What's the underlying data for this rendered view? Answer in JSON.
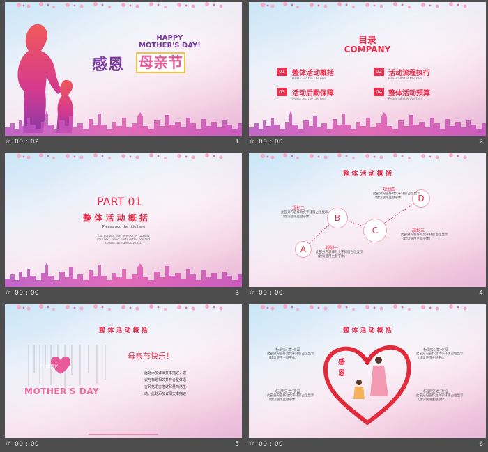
{
  "slides": [
    {
      "num": "1",
      "time": "00 : 02",
      "title_en": "HAPPY\nMOTHER'S DAY!",
      "title_cn_a": "感恩",
      "title_cn_b": "母亲节"
    },
    {
      "num": "2",
      "time": "00 : 00",
      "title": "目录",
      "subtitle": "COMPANY",
      "items": [
        {
          "n": "01",
          "label": "整体活动概括",
          "sub": "Please add the title here"
        },
        {
          "n": "02",
          "label": "活动流程执行",
          "sub": "Please add the title here"
        },
        {
          "n": "03",
          "label": "活动后勤保障",
          "sub": "Please add the title here"
        },
        {
          "n": "04",
          "label": "整体活动预算",
          "sub": "Please add the title here"
        }
      ]
    },
    {
      "num": "3",
      "time": "00 : 00",
      "part": "PART 01",
      "title": "整 体 活 动 概 括",
      "sub": "Please add the title here",
      "desc": "Your content play here, or by copying your text, select paste in this box and choose to retain only text."
    },
    {
      "num": "4",
      "time": "00 : 00",
      "title": "整 体 活 动 概 括",
      "nodes": [
        {
          "letter": "A",
          "label": "规划一",
          "desc": "此部分内容作为文字排版占位显示\n（建议使用主题字体）"
        },
        {
          "letter": "B",
          "label": "规划二",
          "desc": "此部分内容作为文字排版占位显示\n（建议使用主题字体）"
        },
        {
          "letter": "C",
          "label": "规划三",
          "desc": "此部分内容作为文字排版占位显示\n（建议使用主题字体）"
        },
        {
          "letter": "D",
          "label": "规划四",
          "desc": "此部分内容作为文字排版占位显示\n（建议使用主题字体）"
        }
      ]
    },
    {
      "num": "5",
      "time": "00 : 00",
      "title": "整 体 活 动 概 括",
      "heading": "母亲节快乐！",
      "art_a": "Happy",
      "art_b": "MOTHER'S DAY",
      "body": [
        "此处添加详细文本描述，建",
        "议与标题相关并符合整体语",
        "言风格语言描述尽量简洁生",
        "动。此处添加详细文本描述"
      ]
    },
    {
      "num": "6",
      "time": "00 : 00",
      "title": "整 体 活 动 概 括",
      "heart_text": "感\n恩",
      "blocks": [
        {
          "label": "标题文本预设",
          "desc": "此部分内容作为文字排版占位显示\n（建议使用主题字体）"
        },
        {
          "label": "标题文本预设",
          "desc": "此部分内容作为文字排版占位显示\n（建议使用主题字体）"
        },
        {
          "label": "标题文本预设",
          "desc": "此部分内容作为文字排版占位显示\n（建议使用主题字体）"
        },
        {
          "label": "标题文本预设",
          "desc": "此部分内容作为文字排版占位显示\n（建议使用主题字体）"
        }
      ]
    }
  ],
  "colors": {
    "accent": "#e8304e",
    "bg": "#4d4d4d",
    "city": "#c94aa8"
  },
  "icons": {
    "footer": "star-icon"
  }
}
